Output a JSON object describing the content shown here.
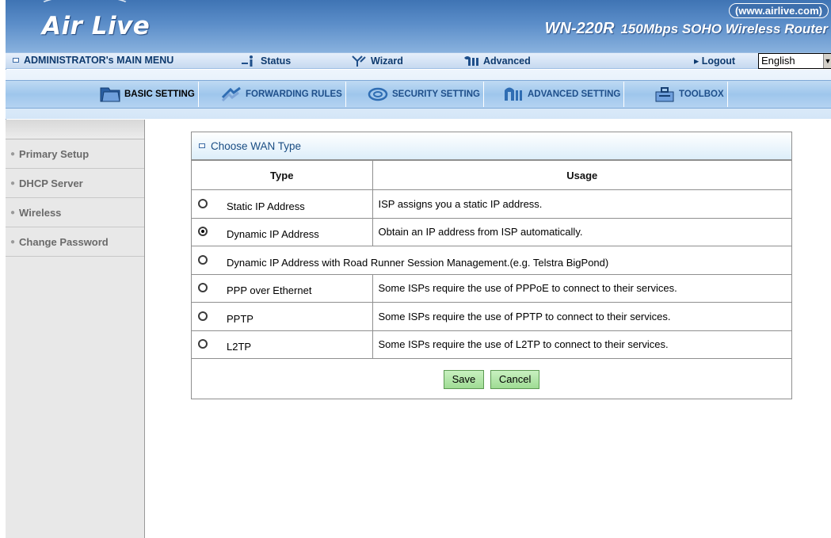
{
  "header": {
    "brand": "Air Live",
    "website": "(www.airlive.com)",
    "model": "WN-220R",
    "description": "150Mbps SOHO Wireless Router"
  },
  "admin_bar": {
    "title": "ADMINISTRATOR's MAIN MENU",
    "status": "Status",
    "wizard": "Wizard",
    "advanced": "Advanced",
    "logout": "▸ Logout",
    "language": "English"
  },
  "tabs": [
    {
      "label": "BASIC SETTING",
      "active": true
    },
    {
      "label": "FORWARDING RULES",
      "active": false
    },
    {
      "label": "SECURITY SETTING",
      "active": false
    },
    {
      "label": "ADVANCED SETTING",
      "active": false
    },
    {
      "label": "TOOLBOX",
      "active": false
    }
  ],
  "sidebar": {
    "items": [
      {
        "label": "Primary Setup"
      },
      {
        "label": "DHCP Server"
      },
      {
        "label": "Wireless"
      },
      {
        "label": "Change Password"
      }
    ]
  },
  "card": {
    "title": "Choose WAN Type",
    "col_type": "Type",
    "col_usage": "Usage",
    "rows": [
      {
        "type": "Static IP Address",
        "usage": "ISP assigns you a static IP address.",
        "checked": false
      },
      {
        "type": "Dynamic IP Address",
        "usage": "Obtain an IP address from ISP automatically.",
        "checked": true
      },
      {
        "type": "Dynamic IP Address with Road Runner Session Management.(e.g. Telstra BigPond)",
        "usage": "",
        "checked": false
      },
      {
        "type": "PPP over Ethernet",
        "usage": "Some ISPs require the use of PPPoE to connect to their services.",
        "checked": false
      },
      {
        "type": "PPTP",
        "usage": "Some ISPs require the use of PPTP to connect to their services.",
        "checked": false
      },
      {
        "type": "L2TP",
        "usage": "Some ISPs require the use of L2TP to connect to their services.",
        "checked": false
      }
    ],
    "save_label": "Save",
    "cancel_label": "Cancel"
  }
}
